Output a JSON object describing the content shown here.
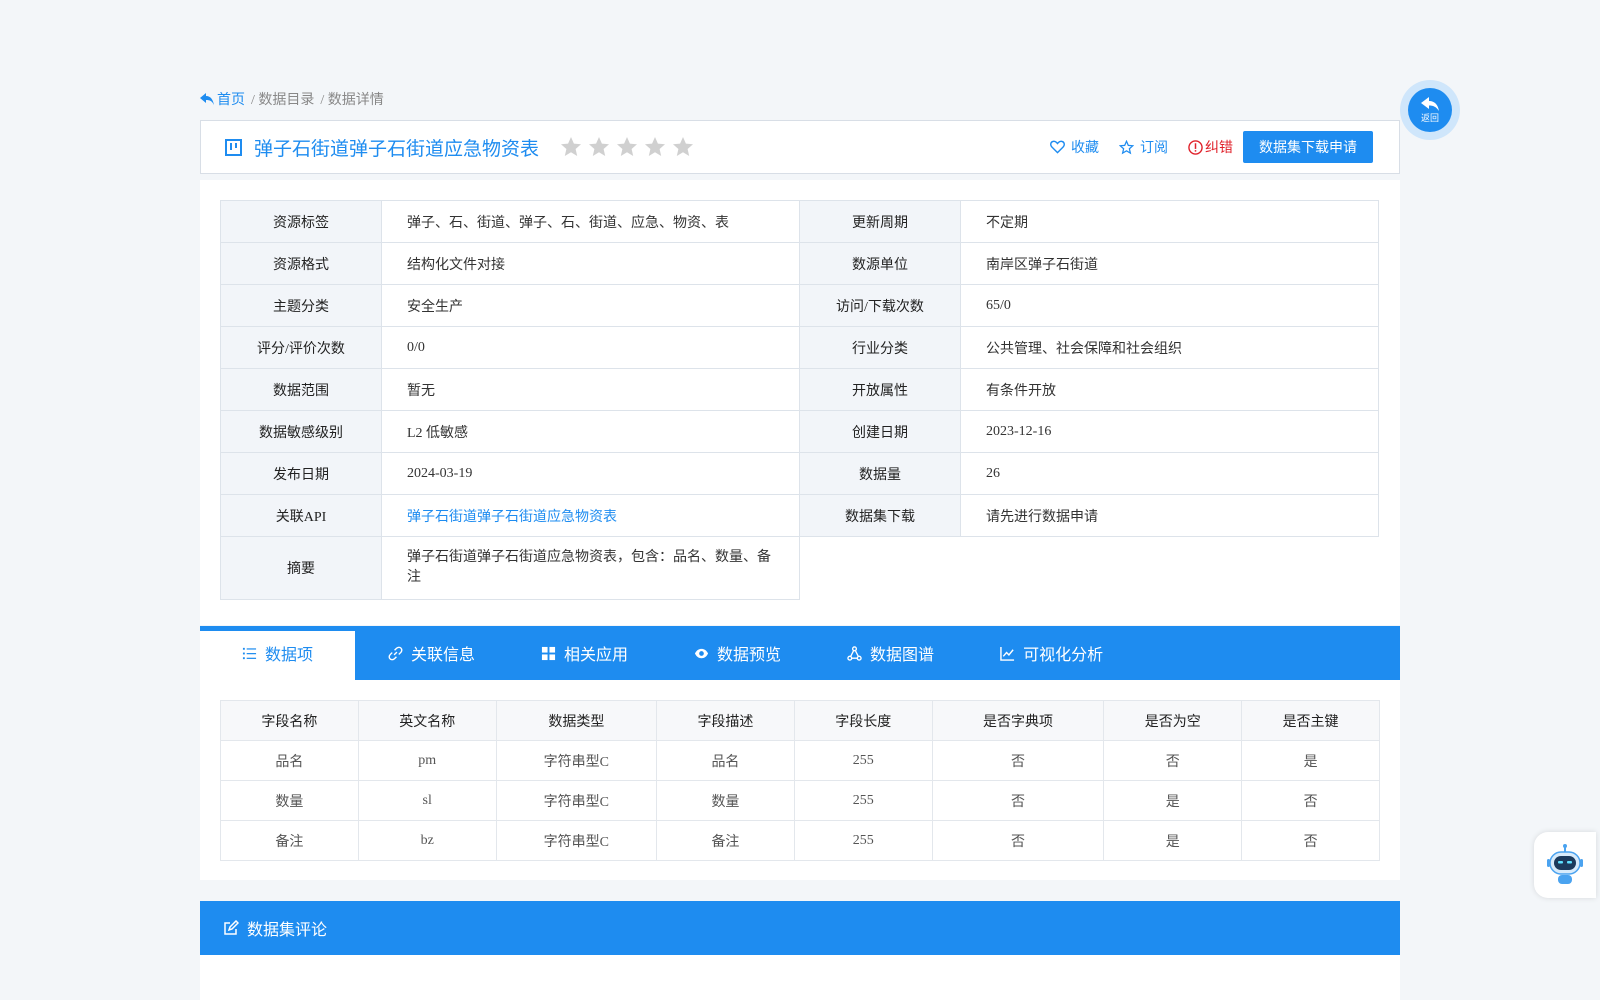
{
  "breadcrumb": {
    "home": "首页",
    "catalog": "/ 数据目录",
    "detail": "/ 数据详情"
  },
  "header": {
    "title": "弹子石街道弹子石街道应急物资表",
    "rating_stars": 0,
    "favorite": "收藏",
    "subscribe": "订阅",
    "correct": "纠错",
    "download_apply": "数据集下载申请"
  },
  "info": {
    "rows": [
      {
        "l1": "资源标签",
        "v1": "弹子、石、街道、弹子、石、街道、应急、物资、表",
        "l2": "更新周期",
        "v2": "不定期"
      },
      {
        "l1": "资源格式",
        "v1": "结构化文件对接",
        "l2": "数源单位",
        "v2": "南岸区弹子石街道"
      },
      {
        "l1": "主题分类",
        "v1": "安全生产",
        "l2": "访问/下载次数",
        "v2": "65/0"
      },
      {
        "l1": "评分/评价次数",
        "v1": "0/0",
        "l2": "行业分类",
        "v2": "公共管理、社会保障和社会组织"
      },
      {
        "l1": "数据范围",
        "v1": "暂无",
        "l2": "开放属性",
        "v2": "有条件开放"
      },
      {
        "l1": "数据敏感级别",
        "v1": "L2 低敏感",
        "l2": "创建日期",
        "v2": "2023-12-16"
      },
      {
        "l1": "发布日期",
        "v1": "2024-03-19",
        "l2": "数据量",
        "v2": "26"
      },
      {
        "l1": "关联API",
        "v1": "弹子石街道弹子石街道应急物资表",
        "l2": "数据集下载",
        "v2": "请先进行数据申请"
      }
    ],
    "summary_label": "摘要",
    "summary_value": "弹子石街道弹子石街道应急物资表，包含：品名、数量、备注"
  },
  "tabs": [
    "数据项",
    "关联信息",
    "相关应用",
    "数据预览",
    "数据图谱",
    "可视化分析"
  ],
  "fields": {
    "headers": [
      "字段名称",
      "英文名称",
      "数据类型",
      "字段描述",
      "字段长度",
      "是否字典项",
      "是否为空",
      "是否主键"
    ],
    "rows": [
      [
        "品名",
        "pm",
        "字符串型C",
        "品名",
        "255",
        "否",
        "否",
        "是"
      ],
      [
        "数量",
        "sl",
        "字符串型C",
        "数量",
        "255",
        "否",
        "是",
        "否"
      ],
      [
        "备注",
        "bz",
        "字符串型C",
        "备注",
        "255",
        "否",
        "是",
        "否"
      ]
    ]
  },
  "comments": {
    "title": "数据集评论"
  },
  "back_float": {
    "label": "返回"
  },
  "colors": {
    "accent": "#1e8cf0",
    "error": "#e0222b",
    "star": "#d0d0d0"
  }
}
